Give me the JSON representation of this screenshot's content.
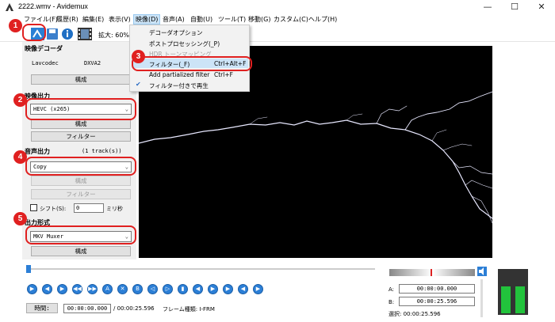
{
  "window": {
    "title": "2222.wmv - Avidemux",
    "controls": [
      "—",
      "☐",
      "✕"
    ]
  },
  "menubar": {
    "items": [
      "ファイル(F)",
      "履歴(R)",
      "編集(E)",
      "表示(V)",
      "映像(D)",
      "音声(A)",
      "自動(U)",
      "ツール(T)",
      "移動(G)",
      "カスタム(C)",
      "ヘルプ(H)"
    ]
  },
  "toolbar": {
    "zoom_label": "拡大: 60%"
  },
  "video_menu": {
    "items": [
      {
        "label": "デコーダオプション",
        "shortcut": "",
        "disabled": false
      },
      {
        "label": "ポストプロセッシング(_P)",
        "shortcut": "",
        "disabled": false
      },
      {
        "label": "HDR トーンマッピング",
        "shortcut": "",
        "disabled": true
      },
      {
        "label": "フィルター(_F)",
        "shortcut": "Ctrl+Alt+F",
        "disabled": false
      },
      {
        "label": "Add partialized filter",
        "shortcut": "Ctrl+F",
        "disabled": false
      },
      {
        "label": "フィルター付きで再生",
        "shortcut": "",
        "disabled": false,
        "checked": true
      }
    ]
  },
  "left_panel": {
    "video_decoder": {
      "title": "映像デコーダ",
      "codec_label": "Lavcodec",
      "codec_value": "DXVA2",
      "configure": "構成"
    },
    "video_output": {
      "title": "映像出力",
      "codec": "HEVC (x265)",
      "configure": "構成",
      "filters": "フィルター"
    },
    "audio_output": {
      "title": "音声出力",
      "tracks": "(1 track(s))",
      "codec": "Copy",
      "configure": "構成",
      "filters": "フィルター",
      "shift_label": "シフト(S):",
      "shift_value": "0",
      "shift_unit": "ミリ秒"
    },
    "output_format": {
      "title": "出力形式",
      "container": "MKV Muxer",
      "configure": "構成"
    }
  },
  "callouts": [
    "1",
    "2",
    "3",
    "4",
    "5"
  ],
  "playback": {
    "time_button": "時間:",
    "current_time": "00:00:00.000",
    "total_time": "/ 00:00:25.596",
    "frame_type": "フレーム種類: I-FRM",
    "a_label": "A:",
    "a_value": "00:00:00.000",
    "b_label": "B:",
    "b_value": "00:00:25.596",
    "selection": "選択: 00:00:25.596",
    "seek_position": 0.0
  },
  "colors": {
    "callout_red": "#e02020",
    "highlight": "#cce4f7",
    "control_blue": "#2c7fd6",
    "meter_green": "#22c33c"
  }
}
